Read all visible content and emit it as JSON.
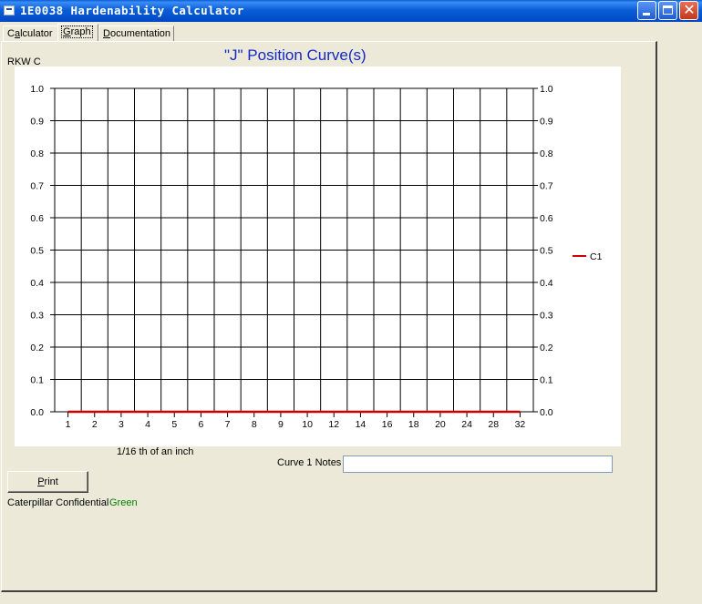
{
  "window": {
    "title": "1E0038 Hardenability Calculator"
  },
  "tabs": [
    {
      "label": "Calculator",
      "accel": "a",
      "pre": "C",
      "post": "lculator"
    },
    {
      "label": "Graph",
      "accel": "G",
      "pre": "",
      "post": "raph"
    },
    {
      "label": "Documentation",
      "accel": "D",
      "pre": "",
      "post": "ocumentation"
    }
  ],
  "active_tab": "Graph",
  "chart_header": {
    "series_label": "RKW C"
  },
  "chart_data": {
    "type": "line",
    "title": "\"J\" Position Curve(s)",
    "xlabel": "1/16 th of an inch",
    "ylabel": "",
    "categories": [
      "1",
      "2",
      "3",
      "4",
      "5",
      "6",
      "7",
      "8",
      "9",
      "10",
      "12",
      "14",
      "16",
      "18",
      "20",
      "24",
      "28",
      "32"
    ],
    "yticks": [
      "0.0",
      "0.1",
      "0.2",
      "0.3",
      "0.4",
      "0.5",
      "0.6",
      "0.7",
      "0.8",
      "0.9",
      "1.0"
    ],
    "ylim": [
      0,
      1
    ],
    "grid": true,
    "legend_position": "right",
    "series": [
      {
        "name": "C1",
        "color": "#cc0000",
        "values": [
          0,
          0,
          0,
          0,
          0,
          0,
          0,
          0,
          0,
          0,
          0,
          0,
          0,
          0,
          0,
          0,
          0,
          0
        ]
      }
    ]
  },
  "notes": {
    "label": "Curve 1 Notes",
    "value": ""
  },
  "print_button": {
    "label": "Print",
    "accel": "P",
    "rest": "rint"
  },
  "footer": {
    "confidential": "Caterpillar Confidential",
    "classification": "Green",
    "classification_color": "#008000"
  }
}
